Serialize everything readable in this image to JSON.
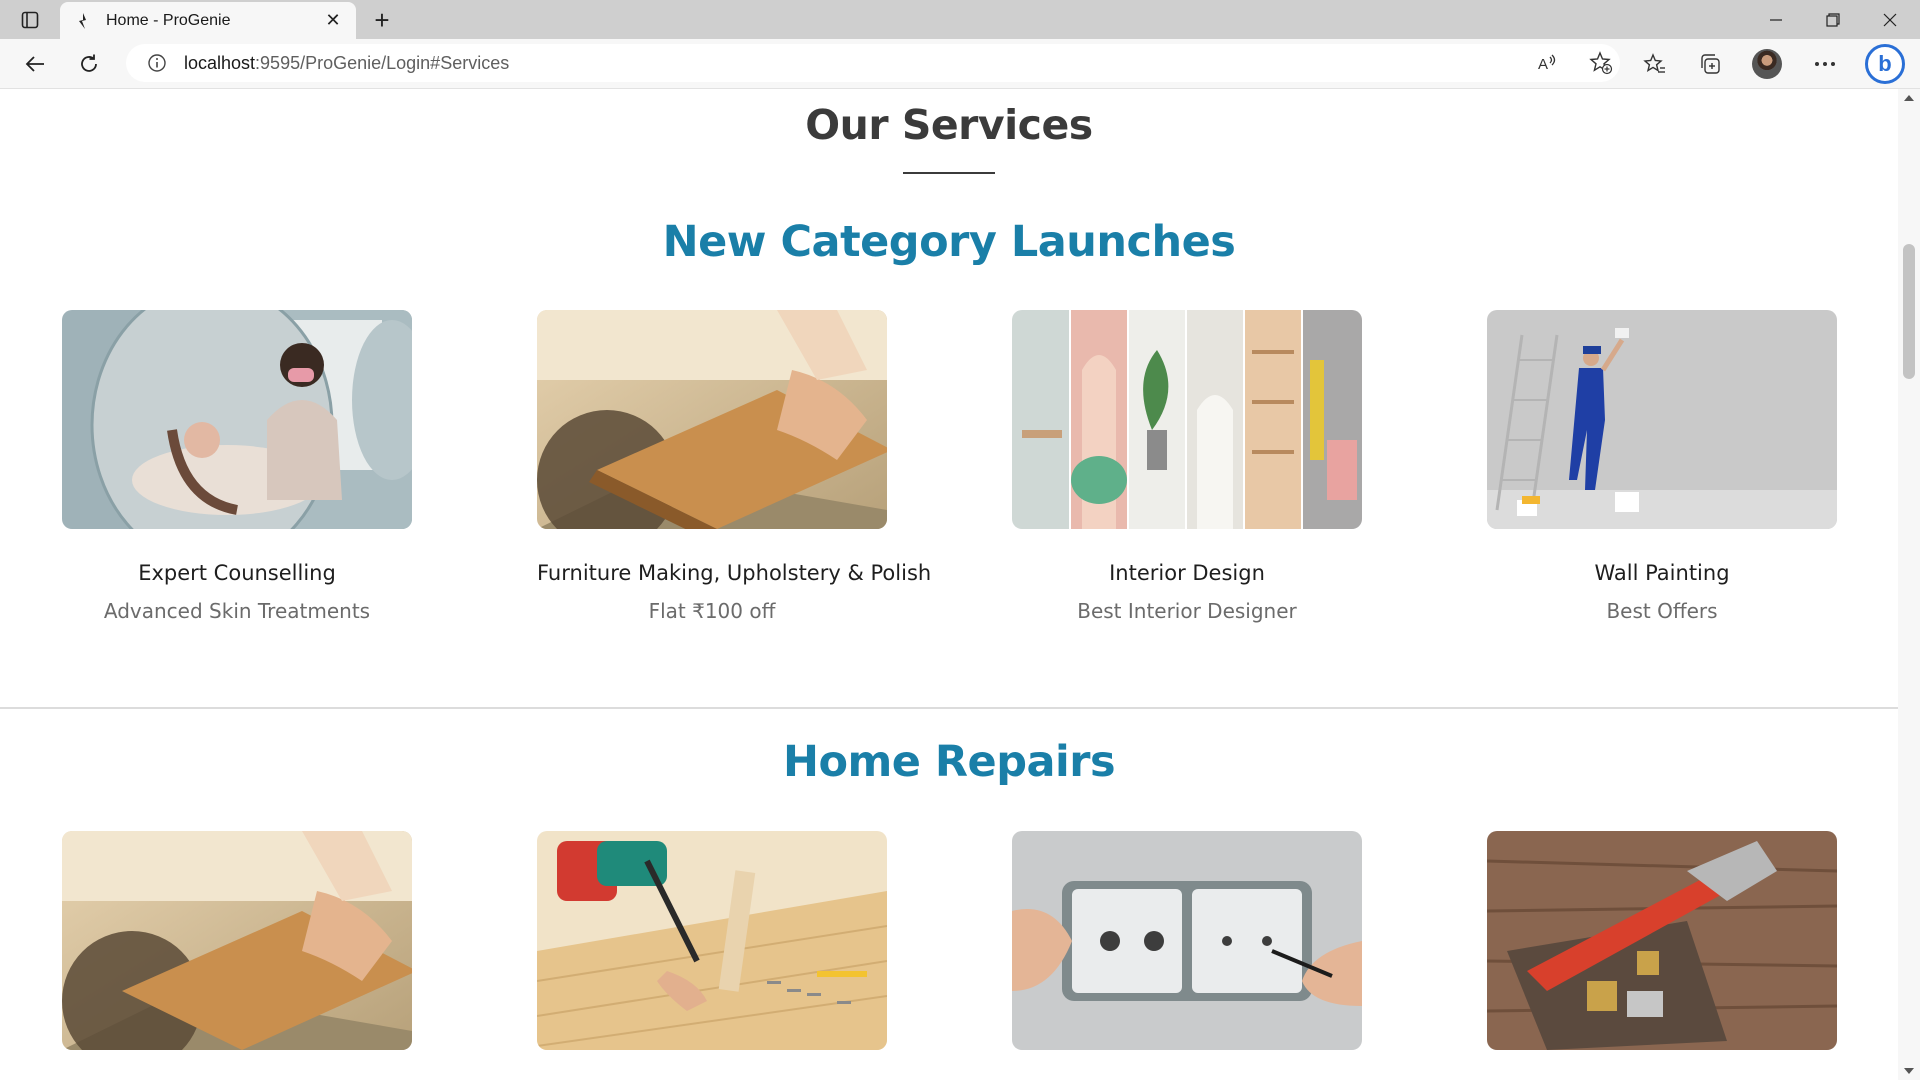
{
  "browser": {
    "tab_title": "Home - ProGenie",
    "url_host": "localhost",
    "url_rest": ":9595/ProGenie/Login#Services"
  },
  "page": {
    "services_heading": "Our Services",
    "sections": [
      {
        "title": "New Category Launches",
        "cards": [
          {
            "name": "Expert Counselling",
            "sub": "Advanced Skin Treatments",
            "image": "skin-treatment-photo"
          },
          {
            "name": "Furniture Making, Upholstery & Polish",
            "sub": "Flat ₹100 off",
            "image": "wood-saw-photo"
          },
          {
            "name": "Interior Design",
            "sub": "Best Interior Designer",
            "image": "interior-collage-photo"
          },
          {
            "name": "Wall Painting",
            "sub": "Best Offers",
            "image": "wall-painter-photo"
          }
        ]
      },
      {
        "title": "Home Repairs",
        "cards": [
          {
            "image": "wood-saw-photo"
          },
          {
            "image": "drilling-photo"
          },
          {
            "image": "electric-socket-photo"
          },
          {
            "image": "plumbing-wrench-photo"
          }
        ]
      }
    ]
  },
  "colors": {
    "accent": "#1a7fa8",
    "heading": "#3b3b3b"
  }
}
